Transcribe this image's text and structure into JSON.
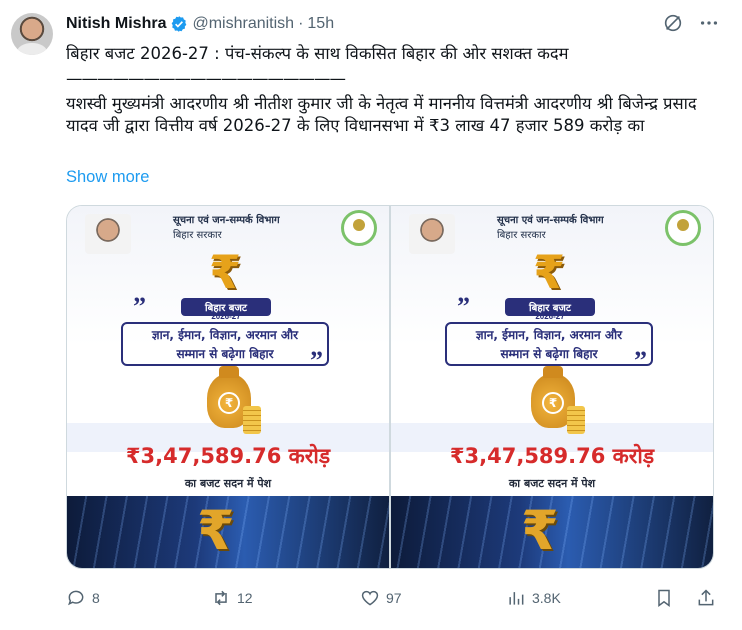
{
  "author": {
    "name": "Nitish Mishra",
    "handle": "@mishranitish",
    "separator": "·",
    "time": "15h"
  },
  "tweet": {
    "line1": "बिहार बजट 2026-27 : पंच-संकल्प के साथ विकसित बिहार की ओर सशक्त कदम",
    "rule": "——————————————————",
    "line2": "यशस्वी मुख्यमंत्री आदरणीय श्री नीतीश कुमार जी के नेतृत्व में माननीय वित्तमंत्री आदरणीय श्री बिजेन्द्र प्रसाद यादव जी द्वारा वित्तीय वर्ष 2026-27 के लिए विधानसभा में ₹3 लाख 47 हजार 589 करोड़ का",
    "show_more": "Show more"
  },
  "media": [
    {
      "dept": "सूचना एवं जन-सम्पर्क विभाग",
      "govt": "बिहार सरकार",
      "logo_symbol": "₹",
      "logo_title": "बिहार बजट",
      "logo_year": "2026-27",
      "quote_line1": "ज्ञान, ईमान, विज्ञान, अरमान और",
      "quote_line2": "सम्मान से बढ़ेगा बिहार",
      "quote_mark": "”",
      "bag_symbol": "₹",
      "amount": "₹3,47,589.76 करोड़",
      "subtext": "का बजट सदन में पेश",
      "big_symbol": "₹"
    },
    {
      "dept": "सूचना एवं जन-सम्पर्क विभाग",
      "govt": "बिहार सरकार",
      "logo_symbol": "₹",
      "logo_title": "बिहार बजट",
      "logo_year": "2026-27",
      "quote_line1": "ज्ञान, ईमान, विज्ञान, अरमान और",
      "quote_line2": "सम्मान से बढ़ेगा बिहार",
      "quote_mark": "”",
      "bag_symbol": "₹",
      "amount": "₹3,47,589.76 करोड़",
      "subtext": "का बजट सदन में पेश",
      "big_symbol": "₹"
    }
  ],
  "stats": {
    "replies": "8",
    "reposts": "12",
    "likes": "97",
    "views": "3.8K"
  },
  "colors": {
    "accent": "#1d9bf0",
    "muted": "#536471",
    "amount_red": "#d62b2b",
    "verified_blue": "#1d9bf0"
  },
  "icons": [
    "verified-badge-icon",
    "grok-icon",
    "more-icon",
    "reply-icon",
    "repost-icon",
    "like-icon",
    "views-icon",
    "bookmark-icon",
    "share-icon"
  ]
}
